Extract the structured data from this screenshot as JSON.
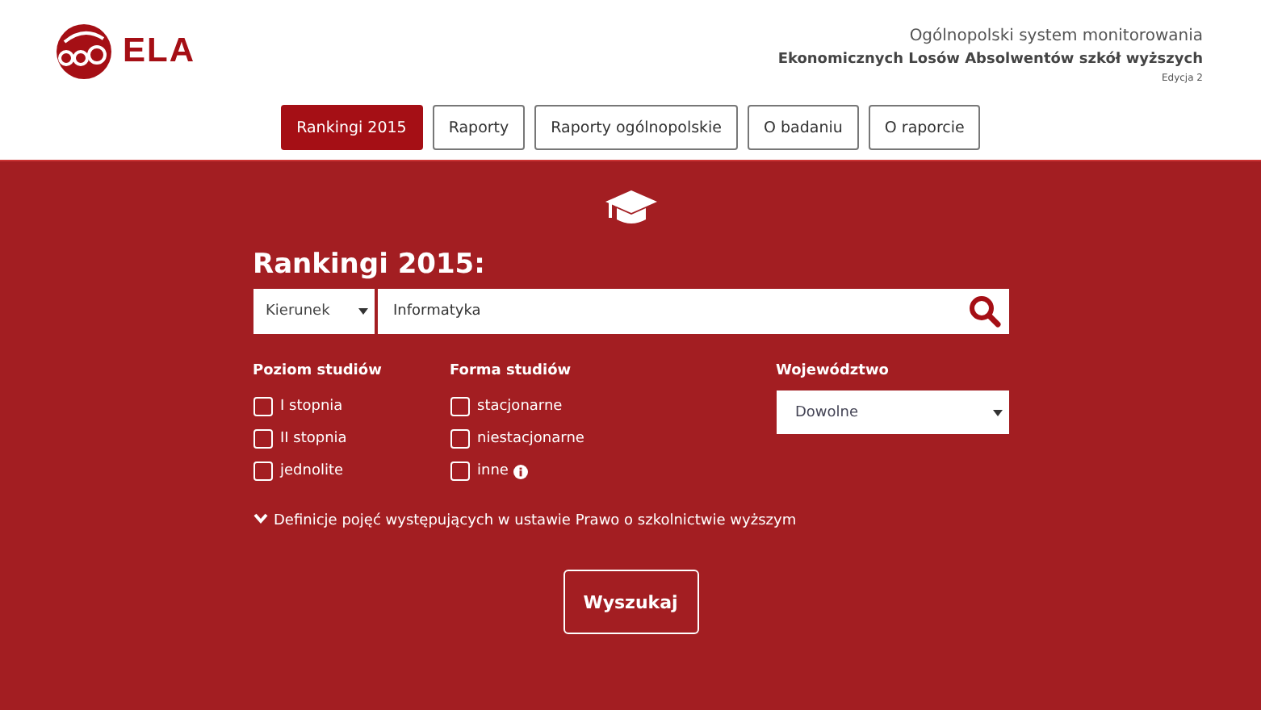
{
  "logo": {
    "text": "ELA"
  },
  "header": {
    "line1": "Ogólnopolski system monitorowania",
    "line2": "Ekonomicznych Losów Absolwentów szkół wyższych",
    "edition": "Edycja 2"
  },
  "nav": [
    {
      "label": "Rankingi 2015",
      "selected": true
    },
    {
      "label": "Raporty",
      "selected": false
    },
    {
      "label": "Raporty ogólnopolskie",
      "selected": false
    },
    {
      "label": "O badaniu",
      "selected": false
    },
    {
      "label": "O raporcie",
      "selected": false
    }
  ],
  "search": {
    "title": "Rankingi 2015:",
    "type_select": "Kierunek",
    "value": "Informatyka"
  },
  "filters": [
    {
      "heading": "Poziom studiów",
      "options": [
        {
          "label": "I stopnia",
          "checked": false,
          "info": false
        },
        {
          "label": "II stopnia",
          "checked": false,
          "info": false
        },
        {
          "label": "jednolite",
          "checked": false,
          "info": false
        }
      ]
    },
    {
      "heading": "Forma studiów",
      "options": [
        {
          "label": "stacjonarne",
          "checked": false,
          "info": false
        },
        {
          "label": "niestacjonarne",
          "checked": false,
          "info": false
        },
        {
          "label": "inne",
          "checked": false,
          "info": true
        }
      ]
    }
  ],
  "region": {
    "heading": "Województwo",
    "value": "Dowolne"
  },
  "definitions_link": {
    "label": "Definicje pojęć występujących w ustawie Prawo o szkolnictwie wyższym",
    "expanded": false
  },
  "submit": "Wyszukaj"
}
